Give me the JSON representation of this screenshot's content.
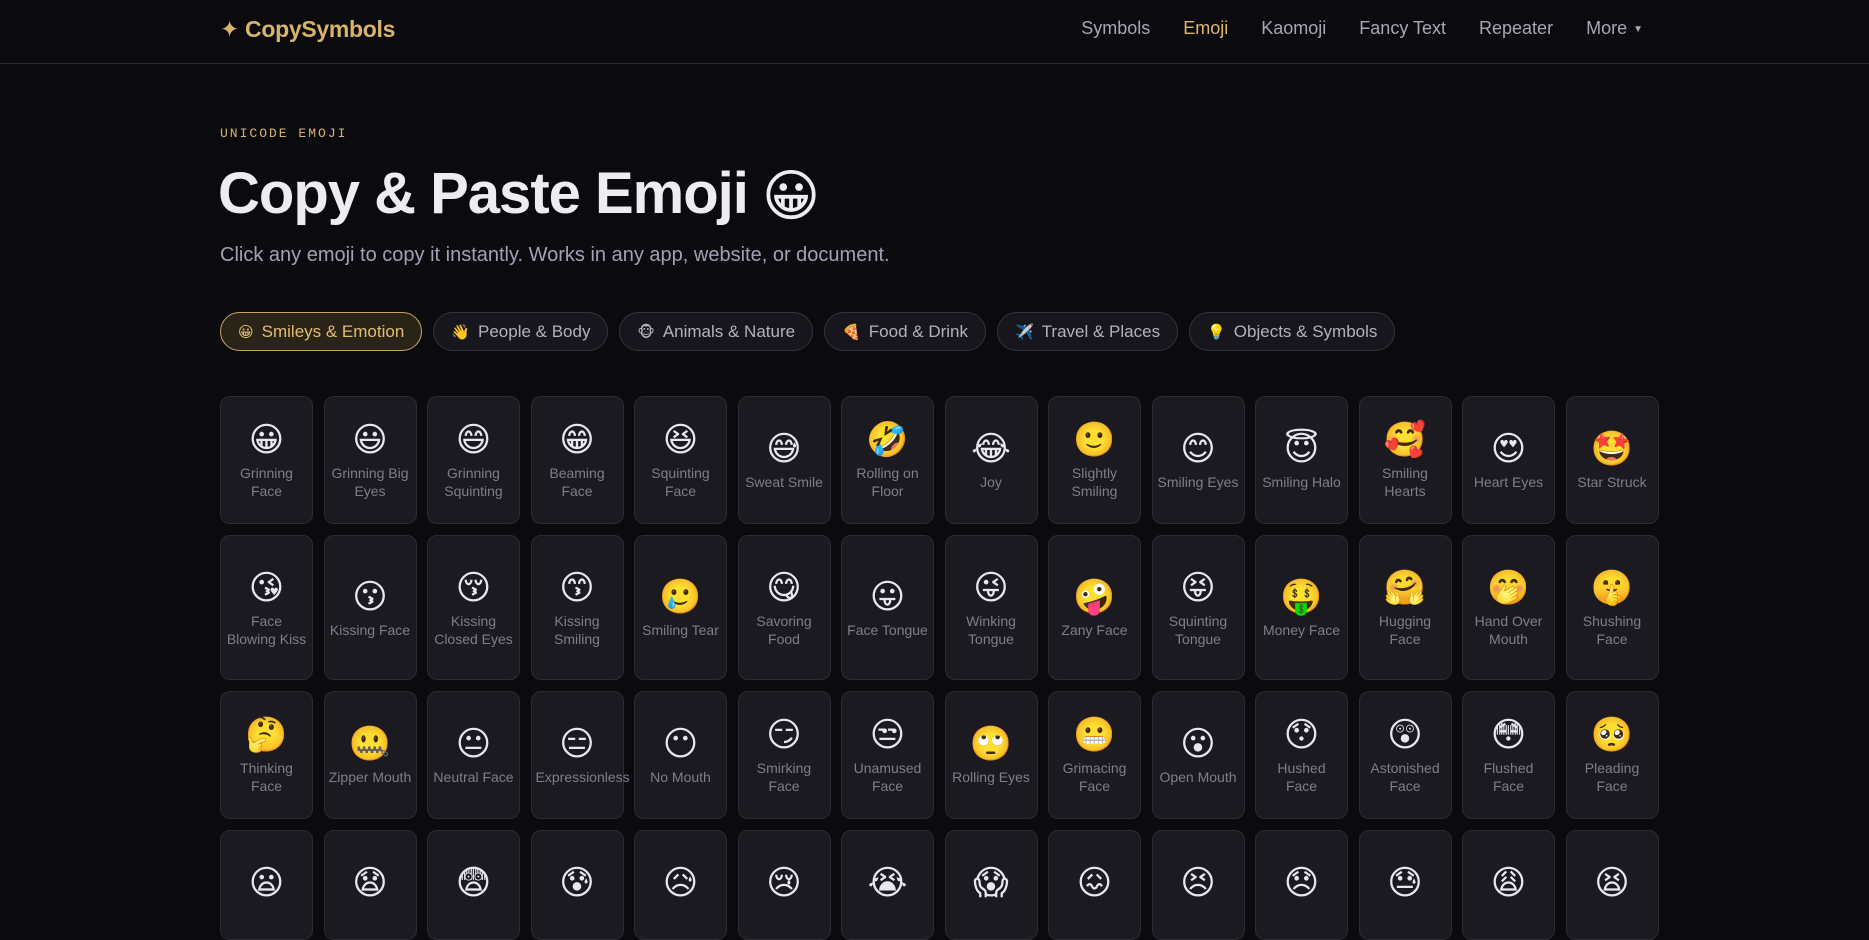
{
  "nav": {
    "logo": "✦ CopySymbols",
    "links": [
      {
        "label": "Symbols",
        "active": false
      },
      {
        "label": "Emoji",
        "active": true
      },
      {
        "label": "Kaomoji",
        "active": false
      },
      {
        "label": "Fancy Text",
        "active": false
      },
      {
        "label": "Repeater",
        "active": false
      },
      {
        "label": "More",
        "active": false
      }
    ],
    "more_caret": "▼"
  },
  "hero": {
    "eyebrow": "UNICODE EMOJI",
    "title": "Copy & Paste Emoji",
    "title_emoji": "😀",
    "subtitle": "Click any emoji to copy it instantly. Works in any app, website, or document."
  },
  "tabs": [
    {
      "icon": "😀",
      "label": "Smileys & Emotion",
      "active": true
    },
    {
      "icon": "👋",
      "label": "People & Body",
      "active": false
    },
    {
      "icon": "🐵",
      "label": "Animals & Nature",
      "active": false
    },
    {
      "icon": "🍕",
      "label": "Food & Drink",
      "active": false
    },
    {
      "icon": "✈️",
      "label": "Travel & Places",
      "active": false
    },
    {
      "icon": "💡",
      "label": "Objects & Symbols",
      "active": false
    }
  ],
  "rows": [
    [
      {
        "emoji": "😀",
        "label": "Grinning Face"
      },
      {
        "emoji": "😃",
        "label": "Grinning Big Eyes"
      },
      {
        "emoji": "😄",
        "label": "Grinning Squinting"
      },
      {
        "emoji": "😁",
        "label": "Beaming Face"
      },
      {
        "emoji": "😆",
        "label": "Squinting Face"
      },
      {
        "emoji": "😅",
        "label": "Sweat Smile"
      },
      {
        "emoji": "🤣",
        "label": "Rolling on Floor"
      },
      {
        "emoji": "😂",
        "label": "Joy"
      },
      {
        "emoji": "🙂",
        "label": "Slightly Smiling"
      },
      {
        "emoji": "😊",
        "label": "Smiling Eyes"
      },
      {
        "emoji": "😇",
        "label": "Smiling Halo"
      },
      {
        "emoji": "🥰",
        "label": "Smiling Hearts"
      },
      {
        "emoji": "😍",
        "label": "Heart Eyes"
      },
      {
        "emoji": "🤩",
        "label": "Star Struck"
      }
    ],
    [
      {
        "emoji": "😘",
        "label": "Face Blowing Kiss"
      },
      {
        "emoji": "😗",
        "label": "Kissing Face"
      },
      {
        "emoji": "😚",
        "label": "Kissing Closed Eyes"
      },
      {
        "emoji": "😙",
        "label": "Kissing Smiling"
      },
      {
        "emoji": "🥲",
        "label": "Smiling Tear"
      },
      {
        "emoji": "😋",
        "label": "Savoring Food"
      },
      {
        "emoji": "😛",
        "label": "Face Tongue"
      },
      {
        "emoji": "😜",
        "label": "Winking Tongue"
      },
      {
        "emoji": "🤪",
        "label": "Zany Face"
      },
      {
        "emoji": "😝",
        "label": "Squinting Tongue"
      },
      {
        "emoji": "🤑",
        "label": "Money Face"
      },
      {
        "emoji": "🤗",
        "label": "Hugging Face"
      },
      {
        "emoji": "🤭",
        "label": "Hand Over Mouth"
      },
      {
        "emoji": "🤫",
        "label": "Shushing Face"
      }
    ],
    [
      {
        "emoji": "🤔",
        "label": "Thinking Face"
      },
      {
        "emoji": "🤐",
        "label": "Zipper Mouth"
      },
      {
        "emoji": "😐",
        "label": "Neutral Face"
      },
      {
        "emoji": "😑",
        "label": "Expressionless"
      },
      {
        "emoji": "😶",
        "label": "No Mouth"
      },
      {
        "emoji": "😏",
        "label": "Smirking Face"
      },
      {
        "emoji": "😒",
        "label": "Unamused Face"
      },
      {
        "emoji": "🙄",
        "label": "Rolling Eyes"
      },
      {
        "emoji": "😬",
        "label": "Grimacing Face"
      },
      {
        "emoji": "😮",
        "label": "Open Mouth"
      },
      {
        "emoji": "😯",
        "label": "Hushed Face"
      },
      {
        "emoji": "😲",
        "label": "Astonished Face"
      },
      {
        "emoji": "😳",
        "label": "Flushed Face"
      },
      {
        "emoji": "🥺",
        "label": "Pleading Face"
      }
    ],
    [
      {
        "emoji": "😦",
        "label": ""
      },
      {
        "emoji": "😧",
        "label": ""
      },
      {
        "emoji": "😨",
        "label": ""
      },
      {
        "emoji": "😰",
        "label": ""
      },
      {
        "emoji": "😥",
        "label": ""
      },
      {
        "emoji": "😢",
        "label": ""
      },
      {
        "emoji": "😭",
        "label": ""
      },
      {
        "emoji": "😱",
        "label": ""
      },
      {
        "emoji": "😖",
        "label": ""
      },
      {
        "emoji": "😣",
        "label": ""
      },
      {
        "emoji": "😞",
        "label": ""
      },
      {
        "emoji": "😓",
        "label": ""
      },
      {
        "emoji": "😩",
        "label": ""
      },
      {
        "emoji": "😫",
        "label": ""
      }
    ]
  ]
}
